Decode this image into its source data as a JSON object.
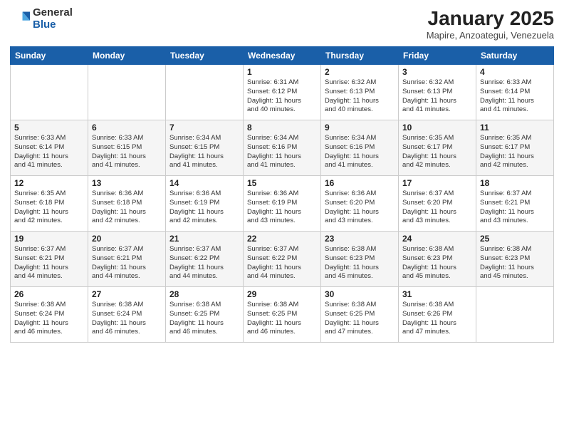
{
  "logo": {
    "general": "General",
    "blue": "Blue"
  },
  "title": {
    "month": "January 2025",
    "location": "Mapire, Anzoategui, Venezuela"
  },
  "weekdays": [
    "Sunday",
    "Monday",
    "Tuesday",
    "Wednesday",
    "Thursday",
    "Friday",
    "Saturday"
  ],
  "weeks": [
    [
      {
        "day": "",
        "info": ""
      },
      {
        "day": "",
        "info": ""
      },
      {
        "day": "",
        "info": ""
      },
      {
        "day": "1",
        "info": "Sunrise: 6:31 AM\nSunset: 6:12 PM\nDaylight: 11 hours\nand 40 minutes."
      },
      {
        "day": "2",
        "info": "Sunrise: 6:32 AM\nSunset: 6:13 PM\nDaylight: 11 hours\nand 40 minutes."
      },
      {
        "day": "3",
        "info": "Sunrise: 6:32 AM\nSunset: 6:13 PM\nDaylight: 11 hours\nand 41 minutes."
      },
      {
        "day": "4",
        "info": "Sunrise: 6:33 AM\nSunset: 6:14 PM\nDaylight: 11 hours\nand 41 minutes."
      }
    ],
    [
      {
        "day": "5",
        "info": "Sunrise: 6:33 AM\nSunset: 6:14 PM\nDaylight: 11 hours\nand 41 minutes."
      },
      {
        "day": "6",
        "info": "Sunrise: 6:33 AM\nSunset: 6:15 PM\nDaylight: 11 hours\nand 41 minutes."
      },
      {
        "day": "7",
        "info": "Sunrise: 6:34 AM\nSunset: 6:15 PM\nDaylight: 11 hours\nand 41 minutes."
      },
      {
        "day": "8",
        "info": "Sunrise: 6:34 AM\nSunset: 6:16 PM\nDaylight: 11 hours\nand 41 minutes."
      },
      {
        "day": "9",
        "info": "Sunrise: 6:34 AM\nSunset: 6:16 PM\nDaylight: 11 hours\nand 41 minutes."
      },
      {
        "day": "10",
        "info": "Sunrise: 6:35 AM\nSunset: 6:17 PM\nDaylight: 11 hours\nand 42 minutes."
      },
      {
        "day": "11",
        "info": "Sunrise: 6:35 AM\nSunset: 6:17 PM\nDaylight: 11 hours\nand 42 minutes."
      }
    ],
    [
      {
        "day": "12",
        "info": "Sunrise: 6:35 AM\nSunset: 6:18 PM\nDaylight: 11 hours\nand 42 minutes."
      },
      {
        "day": "13",
        "info": "Sunrise: 6:36 AM\nSunset: 6:18 PM\nDaylight: 11 hours\nand 42 minutes."
      },
      {
        "day": "14",
        "info": "Sunrise: 6:36 AM\nSunset: 6:19 PM\nDaylight: 11 hours\nand 42 minutes."
      },
      {
        "day": "15",
        "info": "Sunrise: 6:36 AM\nSunset: 6:19 PM\nDaylight: 11 hours\nand 43 minutes."
      },
      {
        "day": "16",
        "info": "Sunrise: 6:36 AM\nSunset: 6:20 PM\nDaylight: 11 hours\nand 43 minutes."
      },
      {
        "day": "17",
        "info": "Sunrise: 6:37 AM\nSunset: 6:20 PM\nDaylight: 11 hours\nand 43 minutes."
      },
      {
        "day": "18",
        "info": "Sunrise: 6:37 AM\nSunset: 6:21 PM\nDaylight: 11 hours\nand 43 minutes."
      }
    ],
    [
      {
        "day": "19",
        "info": "Sunrise: 6:37 AM\nSunset: 6:21 PM\nDaylight: 11 hours\nand 44 minutes."
      },
      {
        "day": "20",
        "info": "Sunrise: 6:37 AM\nSunset: 6:21 PM\nDaylight: 11 hours\nand 44 minutes."
      },
      {
        "day": "21",
        "info": "Sunrise: 6:37 AM\nSunset: 6:22 PM\nDaylight: 11 hours\nand 44 minutes."
      },
      {
        "day": "22",
        "info": "Sunrise: 6:37 AM\nSunset: 6:22 PM\nDaylight: 11 hours\nand 44 minutes."
      },
      {
        "day": "23",
        "info": "Sunrise: 6:38 AM\nSunset: 6:23 PM\nDaylight: 11 hours\nand 45 minutes."
      },
      {
        "day": "24",
        "info": "Sunrise: 6:38 AM\nSunset: 6:23 PM\nDaylight: 11 hours\nand 45 minutes."
      },
      {
        "day": "25",
        "info": "Sunrise: 6:38 AM\nSunset: 6:23 PM\nDaylight: 11 hours\nand 45 minutes."
      }
    ],
    [
      {
        "day": "26",
        "info": "Sunrise: 6:38 AM\nSunset: 6:24 PM\nDaylight: 11 hours\nand 46 minutes."
      },
      {
        "day": "27",
        "info": "Sunrise: 6:38 AM\nSunset: 6:24 PM\nDaylight: 11 hours\nand 46 minutes."
      },
      {
        "day": "28",
        "info": "Sunrise: 6:38 AM\nSunset: 6:25 PM\nDaylight: 11 hours\nand 46 minutes."
      },
      {
        "day": "29",
        "info": "Sunrise: 6:38 AM\nSunset: 6:25 PM\nDaylight: 11 hours\nand 46 minutes."
      },
      {
        "day": "30",
        "info": "Sunrise: 6:38 AM\nSunset: 6:25 PM\nDaylight: 11 hours\nand 47 minutes."
      },
      {
        "day": "31",
        "info": "Sunrise: 6:38 AM\nSunset: 6:26 PM\nDaylight: 11 hours\nand 47 minutes."
      },
      {
        "day": "",
        "info": ""
      }
    ]
  ]
}
